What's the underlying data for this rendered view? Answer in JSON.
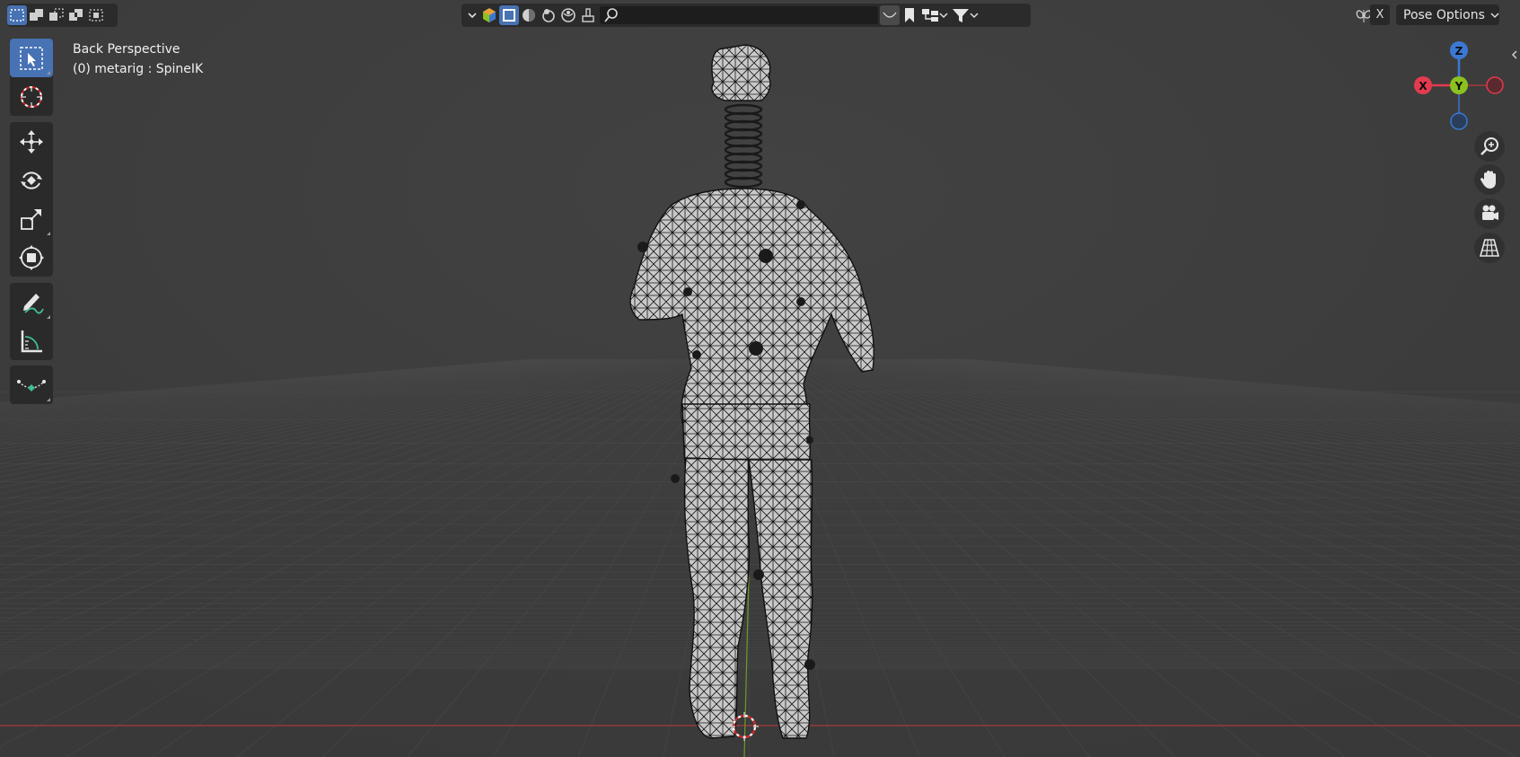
{
  "overlay": {
    "view_name": "Back Perspective",
    "object_info": "(0) metarig : SpineIK"
  },
  "header": {
    "pose_options_label": "Pose Options",
    "x_label": "X",
    "search": {
      "value": "",
      "placeholder": ""
    }
  },
  "gizmo": {
    "x_label": "X",
    "y_label": "Y",
    "z_label": "Z"
  },
  "colors": {
    "viewport_bg": "#3d3d3d",
    "accent": "#4772b3",
    "axis_x": "#e43a4f",
    "axis_y": "#8bc21f",
    "axis_z": "#3a78d4",
    "floor_red_line": "#a83a3a",
    "floor_green_line": "#6e9b2a"
  },
  "icons": {
    "header_left": [
      "select-new-icon",
      "select-extend-icon",
      "select-subtract-icon",
      "select-invert-icon",
      "select-intersect-icon"
    ],
    "header_center": [
      "dropdown-chevron-icon",
      "overlay-gizmo-icon",
      "wireframe-shading-icon",
      "solid-shading-icon",
      "material-shading-icon",
      "rendered-shading-icon",
      "paint-brush-icon",
      "search-icon",
      "curve-icon",
      "bookmark-icon",
      "hierarchy-icon",
      "filter-icon"
    ],
    "toolbar": [
      "select-box-icon",
      "cursor-icon",
      "move-icon",
      "rotate-icon",
      "scale-icon",
      "transform-icon",
      "annotate-icon",
      "measure-icon",
      "relax-icon"
    ],
    "nav": [
      "zoom-icon",
      "pan-hand-icon",
      "camera-icon",
      "grid-perspective-icon"
    ]
  }
}
